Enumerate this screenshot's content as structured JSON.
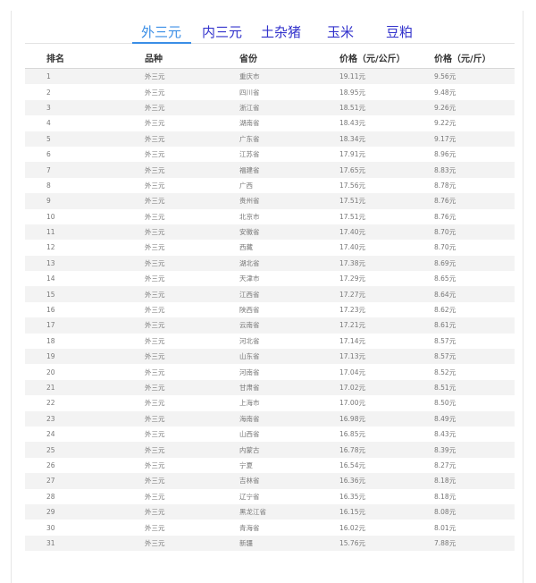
{
  "tabs": [
    "外三元",
    "内三元",
    "土杂猪",
    "玉米",
    "豆粕"
  ],
  "table": {
    "headers": [
      "排名",
      "品种",
      "省份",
      "价格（元/公斤）",
      "价格（元/斤）"
    ],
    "rows": [
      [
        "1",
        "外三元",
        "重庆市",
        "19.11元",
        "9.56元"
      ],
      [
        "2",
        "外三元",
        "四川省",
        "18.95元",
        "9.48元"
      ],
      [
        "3",
        "外三元",
        "浙江省",
        "18.51元",
        "9.26元"
      ],
      [
        "4",
        "外三元",
        "湖南省",
        "18.43元",
        "9.22元"
      ],
      [
        "5",
        "外三元",
        "广东省",
        "18.34元",
        "9.17元"
      ],
      [
        "6",
        "外三元",
        "江苏省",
        "17.91元",
        "8.96元"
      ],
      [
        "7",
        "外三元",
        "福建省",
        "17.65元",
        "8.83元"
      ],
      [
        "8",
        "外三元",
        "广西",
        "17.56元",
        "8.78元"
      ],
      [
        "9",
        "外三元",
        "贵州省",
        "17.51元",
        "8.76元"
      ],
      [
        "10",
        "外三元",
        "北京市",
        "17.51元",
        "8.76元"
      ],
      [
        "11",
        "外三元",
        "安徽省",
        "17.40元",
        "8.70元"
      ],
      [
        "12",
        "外三元",
        "西藏",
        "17.40元",
        "8.70元"
      ],
      [
        "13",
        "外三元",
        "湖北省",
        "17.38元",
        "8.69元"
      ],
      [
        "14",
        "外三元",
        "天津市",
        "17.29元",
        "8.65元"
      ],
      [
        "15",
        "外三元",
        "江西省",
        "17.27元",
        "8.64元"
      ],
      [
        "16",
        "外三元",
        "陕西省",
        "17.23元",
        "8.62元"
      ],
      [
        "17",
        "外三元",
        "云南省",
        "17.21元",
        "8.61元"
      ],
      [
        "18",
        "外三元",
        "河北省",
        "17.14元",
        "8.57元"
      ],
      [
        "19",
        "外三元",
        "山东省",
        "17.13元",
        "8.57元"
      ],
      [
        "20",
        "外三元",
        "河南省",
        "17.04元",
        "8.52元"
      ],
      [
        "21",
        "外三元",
        "甘肃省",
        "17.02元",
        "8.51元"
      ],
      [
        "22",
        "外三元",
        "上海市",
        "17.00元",
        "8.50元"
      ],
      [
        "23",
        "外三元",
        "海南省",
        "16.98元",
        "8.49元"
      ],
      [
        "24",
        "外三元",
        "山西省",
        "16.85元",
        "8.43元"
      ],
      [
        "25",
        "外三元",
        "内蒙古",
        "16.78元",
        "8.39元"
      ],
      [
        "26",
        "外三元",
        "宁夏",
        "16.54元",
        "8.27元"
      ],
      [
        "27",
        "外三元",
        "吉林省",
        "16.36元",
        "8.18元"
      ],
      [
        "28",
        "外三元",
        "辽宁省",
        "16.35元",
        "8.18元"
      ],
      [
        "29",
        "外三元",
        "黑龙江省",
        "16.15元",
        "8.08元"
      ],
      [
        "30",
        "外三元",
        "青海省",
        "16.02元",
        "8.01元"
      ],
      [
        "31",
        "外三元",
        "新疆",
        "15.76元",
        "7.88元"
      ]
    ]
  }
}
